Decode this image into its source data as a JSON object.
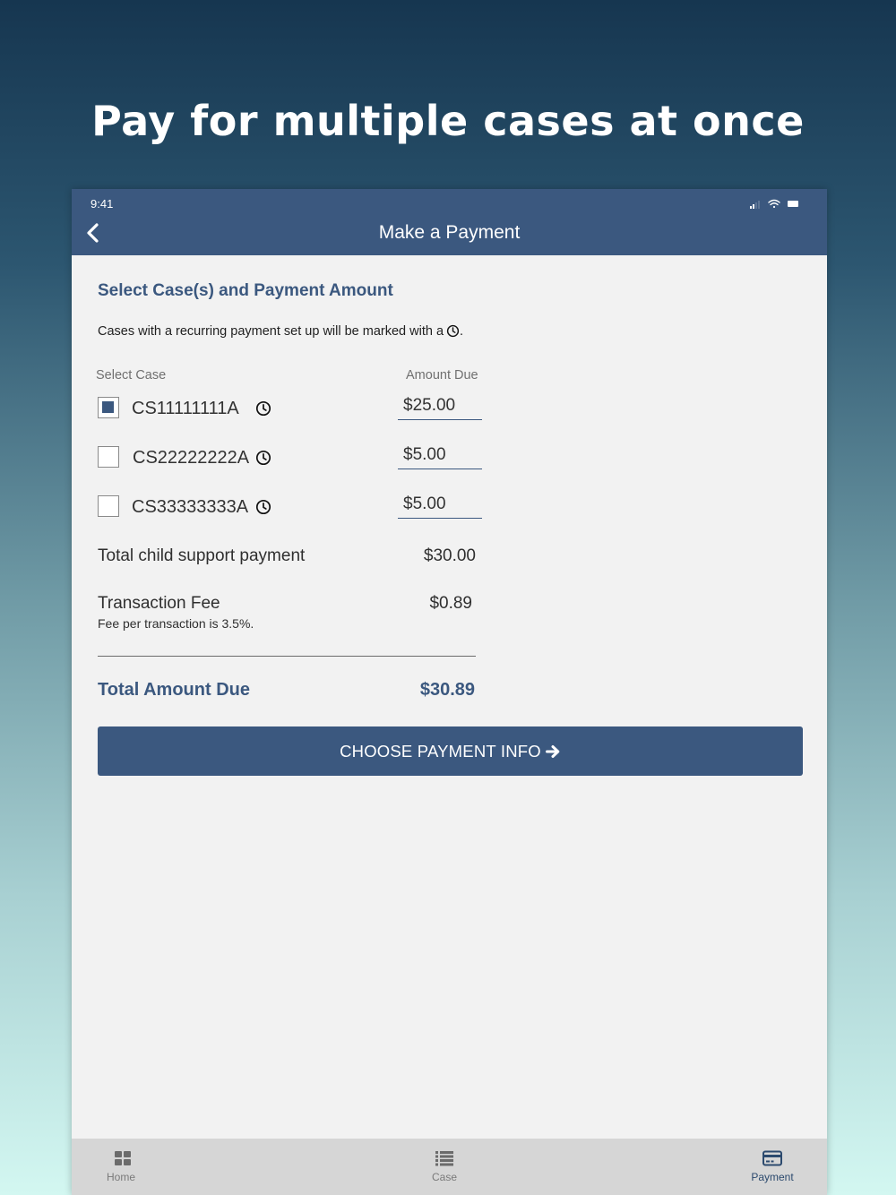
{
  "promo": {
    "title": "Pay for multiple cases at once"
  },
  "status_bar": {
    "time": "9:41"
  },
  "nav": {
    "title": "Make a Payment",
    "back_icon": "chevron-left-icon"
  },
  "form": {
    "section_title": "Select Case(s) and Payment Amount",
    "recurring_notice": "Cases with a recurring payment set up will be marked with a",
    "recurring_notice_end": ".",
    "col_select_case": "Select Case",
    "col_amount_due": "Amount Due",
    "cases": [
      {
        "id": "CS11111111A",
        "amount": "$25.00",
        "checked": true,
        "recurring": true
      },
      {
        "id": "CS22222222A",
        "amount": "$5.00",
        "checked": false,
        "recurring": true
      },
      {
        "id": "CS33333333A",
        "amount": "$5.00",
        "checked": false,
        "recurring": true
      }
    ],
    "total_child_support_label": "Total child support payment",
    "total_child_support_value": "$30.00",
    "transaction_fee_label": "Transaction Fee",
    "transaction_fee_value": "$0.89",
    "fee_note": "Fee per transaction is 3.5%.",
    "total_due_label": "Total Amount Due",
    "total_due_value": "$30.89",
    "cta_label": "CHOOSE PAYMENT INFO"
  },
  "tabbar": {
    "tabs": [
      {
        "label": "Home",
        "icon": "grid-icon",
        "active": false
      },
      {
        "label": "Case",
        "icon": "list-icon",
        "active": false
      },
      {
        "label": "Payment",
        "icon": "credit-card-icon",
        "active": true
      }
    ]
  },
  "colors": {
    "primary": "#3b587f",
    "background": "#f2f2f2",
    "tabbar": "#d6d6d6"
  }
}
